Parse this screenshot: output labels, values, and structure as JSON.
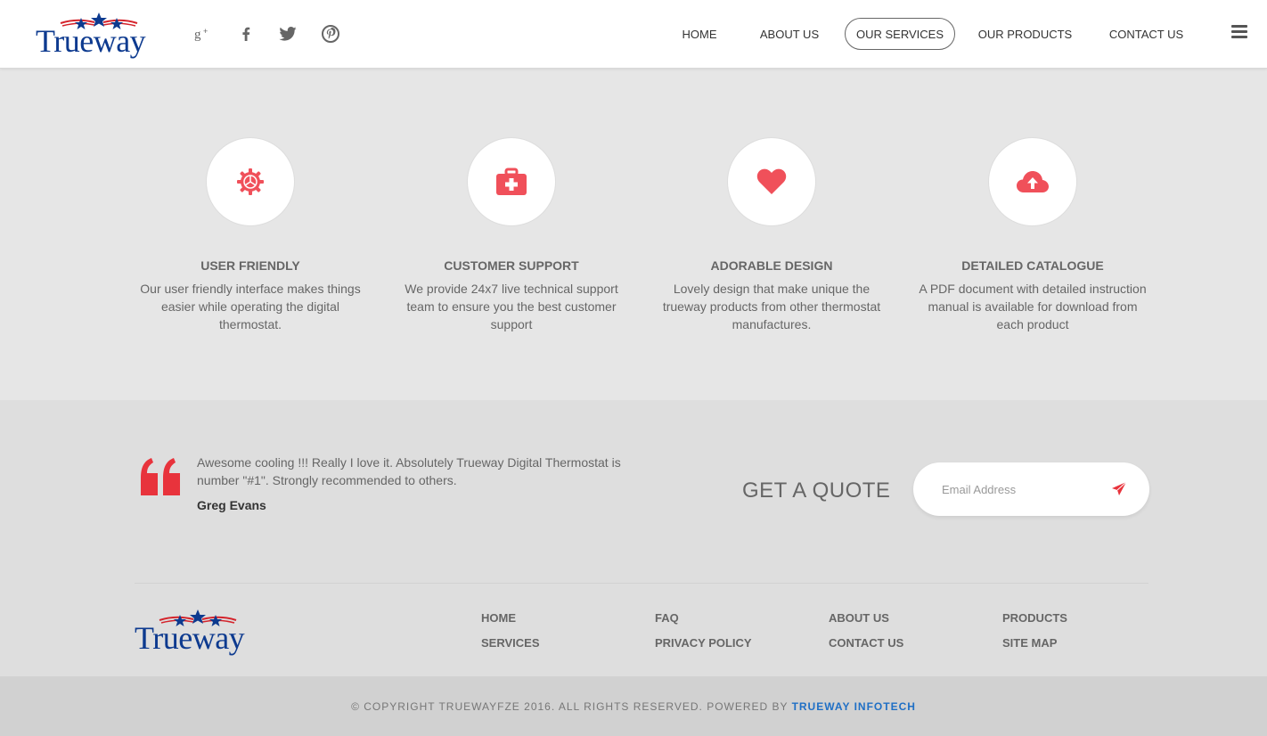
{
  "header": {
    "logo_text": "Trueway",
    "social": [
      {
        "name": "google-plus-icon"
      },
      {
        "name": "facebook-icon"
      },
      {
        "name": "twitter-icon"
      },
      {
        "name": "pinterest-icon"
      }
    ],
    "nav": [
      {
        "label": "HOME",
        "active": false
      },
      {
        "label": "ABOUT US",
        "active": false
      },
      {
        "label": "OUR SERVICES",
        "active": true
      },
      {
        "label": "OUR PRODUCTS",
        "active": false
      },
      {
        "label": "CONTACT US",
        "active": false
      }
    ]
  },
  "features": [
    {
      "icon": "gear-icon",
      "title": "USER FRIENDLY",
      "desc": "Our user friendly interface makes things easier while operating the digital thermostat."
    },
    {
      "icon": "medkit-icon",
      "title": "CUSTOMER SUPPORT",
      "desc": "We provide 24x7 live technical support team to ensure you the best customer support"
    },
    {
      "icon": "heart-icon",
      "title": "ADORABLE DESIGN",
      "desc": "Lovely design that make unique the trueway products from other thermostat manufactures."
    },
    {
      "icon": "cloud-upload-icon",
      "title": "DETAILED CATALOGUE",
      "desc": "A PDF document with detailed instruction manual is available for download from each product"
    }
  ],
  "testimonial": {
    "text": "Awesome cooling !!! Really I love it. Absolutely Trueway Digital Thermostat is number \"#1\". Strongly recommended to others.",
    "author": "Greg Evans"
  },
  "quote": {
    "title": "GET A QUOTE",
    "email_placeholder": "Email Address",
    "email_value": ""
  },
  "footer": {
    "logo_text": "Trueway",
    "links": [
      "HOME",
      "SERVICES",
      "FAQ",
      "PRIVACY POLICY",
      "ABOUT US",
      "CONTACT US",
      "PRODUCTS",
      "SITE MAP"
    ]
  },
  "copyright": {
    "text": "© COPYRIGHT TRUEWAYFZE 2016. ALL RIGHTS RESERVED. POWERED BY",
    "company": "TRUEWAY INFOTECH"
  },
  "colors": {
    "accent": "#f0505a",
    "brand_blue": "#0d3a8f",
    "link_blue": "#1f6fc5"
  }
}
